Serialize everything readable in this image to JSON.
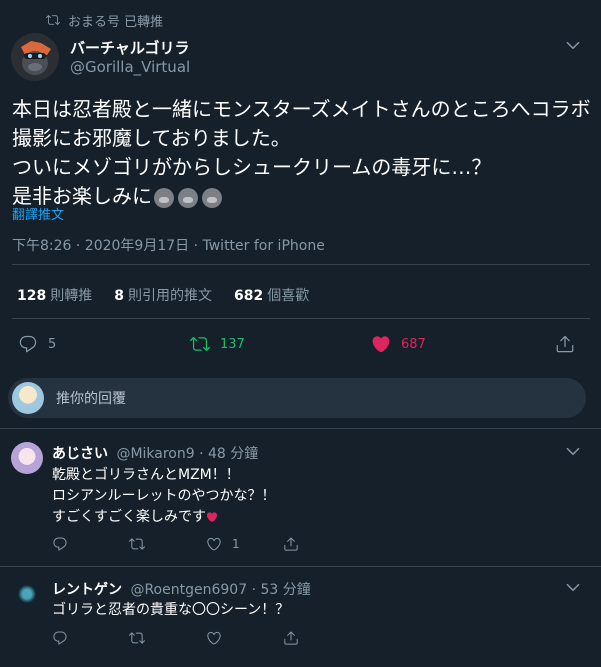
{
  "retweet_context": {
    "text": "おまる号 已轉推",
    "icon": "retweet-icon"
  },
  "tweet": {
    "display_name": "バーチャルゴリラ",
    "handle": "@Gorilla_Virtual",
    "text": "本日は忍者殿と一緒にモンスターズメイトさんのところへコラボ撮影にお邪魔しておりました。\nついにメゾゴリがからしシュークリームの毒牙に…？\n是非お楽しみに",
    "emoji_names": [
      "gorilla-emoji",
      "gorilla-emoji",
      "gorilla-emoji"
    ],
    "translate_label": "翻譯推文",
    "timestamp": "下午8:26 · 2020年9月17日 · Twitter for iPhone"
  },
  "stats": {
    "retweets": {
      "count": "128",
      "label": "則轉推"
    },
    "quotes": {
      "count": "8",
      "label": "則引用的推文"
    },
    "likes": {
      "count": "682",
      "label": "個喜歡"
    }
  },
  "actions": {
    "reply_count": "5",
    "retweet_count": "137",
    "like_count": "687",
    "retweet_color": "#17bf63",
    "like_color": "#e0245e"
  },
  "reply_box": {
    "placeholder": "推你的回覆"
  },
  "replies": [
    {
      "name": "あじさい",
      "handle": "@Mikaron9",
      "time": "· 48 分鐘",
      "text": "乾殿とゴリラさんとMZM！！\nロシアンルーレットのやつかな？！\nすごくすごく楽しみです",
      "like_count": "1"
    },
    {
      "name": "レントゲン",
      "handle": "@Roentgen6907",
      "time": "· 53 分鐘",
      "text": "ゴリラと忍者の貴重な〇〇シーン！？",
      "like_count": ""
    }
  ],
  "colors": {
    "background": "#15202b",
    "accent": "#1da1f2",
    "muted": "#8899a6",
    "divider": "#38444d"
  }
}
